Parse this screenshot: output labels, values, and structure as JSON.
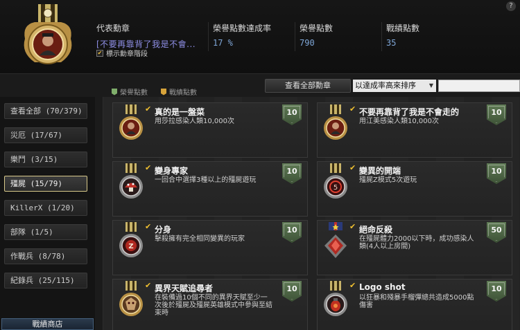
{
  "header": {
    "help": "?",
    "rep_label": "代表勳章",
    "rep_value": "[不要再靠背了我是不會...",
    "rate_label": "榮譽點數達成率",
    "rate_value": "17 %",
    "honor_label": "榮譽點數",
    "honor_value": "790",
    "battle_label": "戰績點數",
    "battle_value": "35",
    "show_tier": "標示勳章階段"
  },
  "legend": {
    "honor": "榮譽點數",
    "battle": "戰績點數",
    "honor_color": "#7fae6b",
    "battle_color": "#d7a33a"
  },
  "toolbar": {
    "view_all": "查看全部勳章",
    "sort_value": "以達成率高來排序",
    "search_placeholder": ""
  },
  "sidebar": {
    "items": [
      {
        "label": "查看全部 (70/379)"
      },
      {
        "label": "災厄 (17/67)"
      },
      {
        "label": "樂鬥 (3/15)"
      },
      {
        "label": "殭屍 (15/79)"
      },
      {
        "label": "KillerX (1/20)"
      },
      {
        "label": "部隊 (1/5)"
      },
      {
        "label": "作戰兵 (8/78)"
      },
      {
        "label": "紀錄兵 (25/115)"
      }
    ],
    "shop": "戰績商店"
  },
  "cards": [
    {
      "title": "真的是一盤菜",
      "desc": "用莎拉感染人類10,000次",
      "points": "10",
      "icon": "portrait-medal-icon"
    },
    {
      "title": "不要再靠背了我是不會走的",
      "desc": "用江美感染人類10,000次",
      "points": "10",
      "icon": "portrait-medal-icon"
    },
    {
      "title": "變身專家",
      "desc": "一回合中選擇3種以上的殭屍遊玩",
      "points": "10",
      "icon": "mushroom-medal-icon"
    },
    {
      "title": "變異的開端",
      "desc": "殭屍Z模式5次遊玩",
      "points": "10",
      "icon": "number-five-medal-icon"
    },
    {
      "title": "分身",
      "desc": "擊殺擁有完全相同變異的玩家",
      "points": "10",
      "icon": "z-medal-icon"
    },
    {
      "title": "絕命反殺",
      "desc": "在殭屍體力2000以下時，成功感染人類(4人以上房間)",
      "points": "50",
      "icon": "red-gem-medal-icon"
    },
    {
      "title": "異界天賦追尋者",
      "desc": "在裝備過10個不同的異界天賦至少一次後於殭屍及殭屍英雄模式中參與至結束時",
      "points": "10",
      "icon": "beast-medal-icon"
    },
    {
      "title": "Logo shot",
      "desc": "以狂暴和殘暴手榴彈總共造成5000點傷害",
      "points": "10",
      "icon": "grenade-medal-icon"
    }
  ]
}
